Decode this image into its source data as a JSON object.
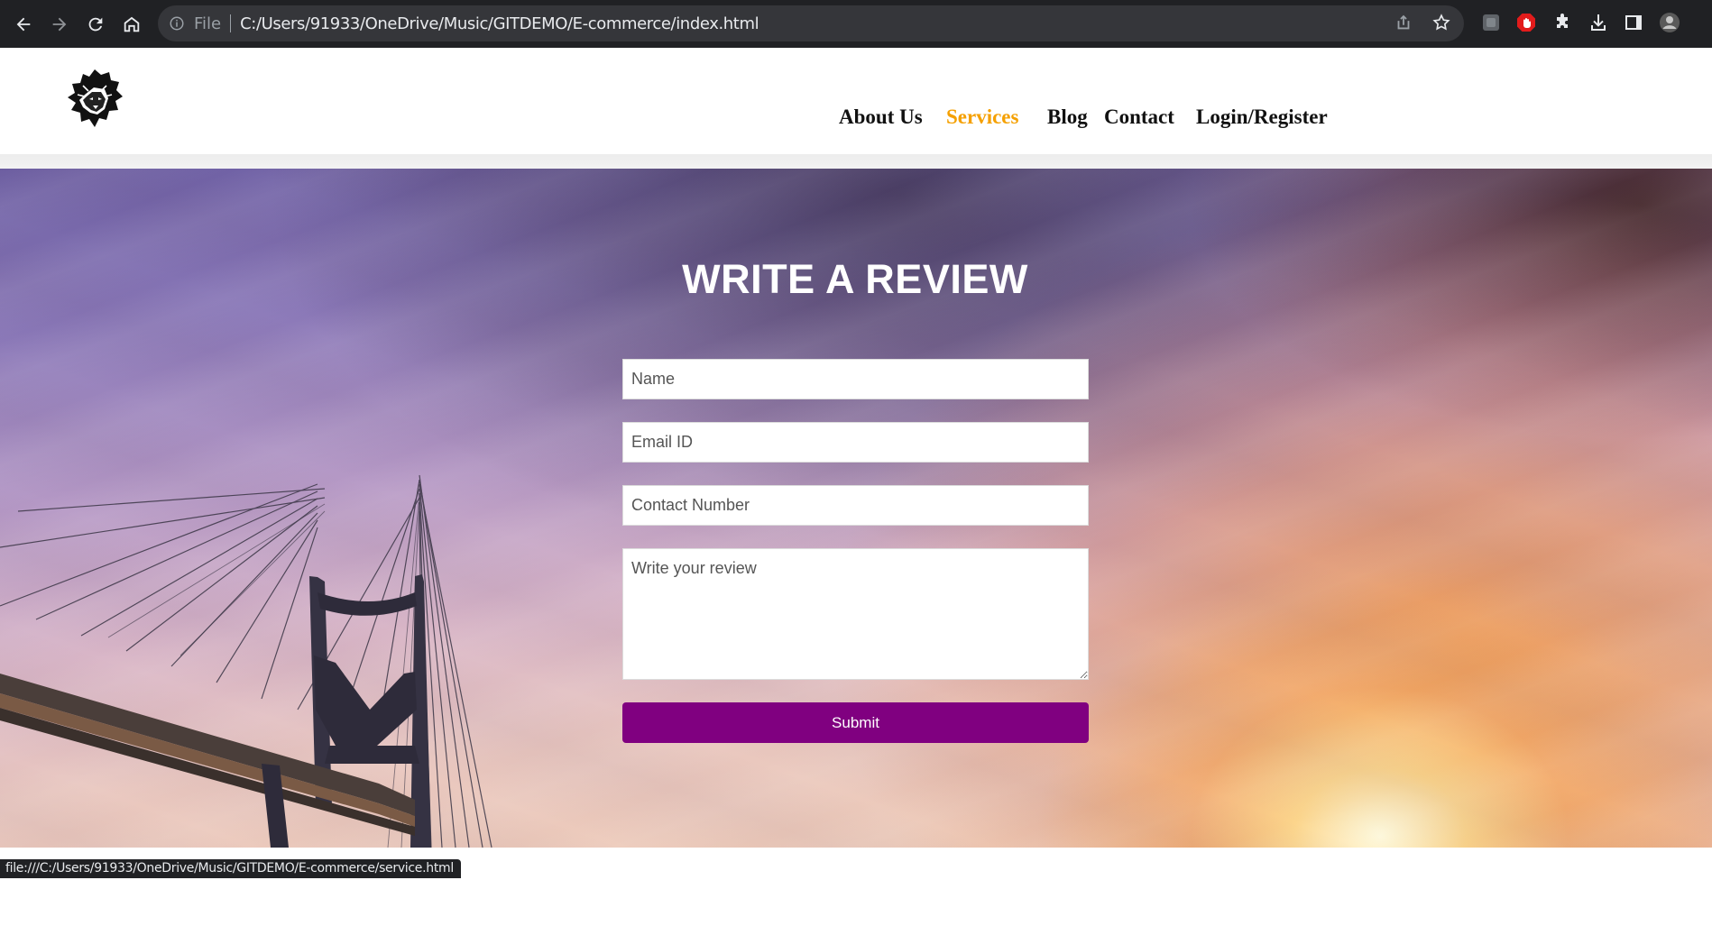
{
  "browser": {
    "scheme_label": "File",
    "url": "C:/Users/91933/OneDrive/Music/GITDEMO/E-commerce/index.html",
    "status_url": "file:///C:/Users/91933/OneDrive/Music/GITDEMO/E-commerce/service.html",
    "icons": [
      "back-arrow-icon",
      "forward-arrow-icon",
      "reload-icon",
      "home-icon",
      "info-icon",
      "share-icon",
      "bookmark-star-icon",
      "extension-icon",
      "adblock-icon",
      "puzzle-icon",
      "download-icon",
      "side-panel-icon",
      "profile-avatar-icon"
    ]
  },
  "site": {
    "logo_icon": "lion-head-logo",
    "nav": [
      {
        "label": "About Us",
        "active": false
      },
      {
        "label": "Services",
        "active": true
      },
      {
        "label": "Blog",
        "active": false
      },
      {
        "label": "Contact",
        "active": false
      },
      {
        "label": "Login/Register",
        "active": false
      }
    ],
    "accent_color": "#f5a000"
  },
  "review": {
    "title": "WRITE A REVIEW",
    "name_placeholder": "Name",
    "email_placeholder": "Email ID",
    "contact_placeholder": "Contact Number",
    "review_placeholder": "Write your review",
    "submit_label": "Submit",
    "submit_color": "#800080"
  }
}
